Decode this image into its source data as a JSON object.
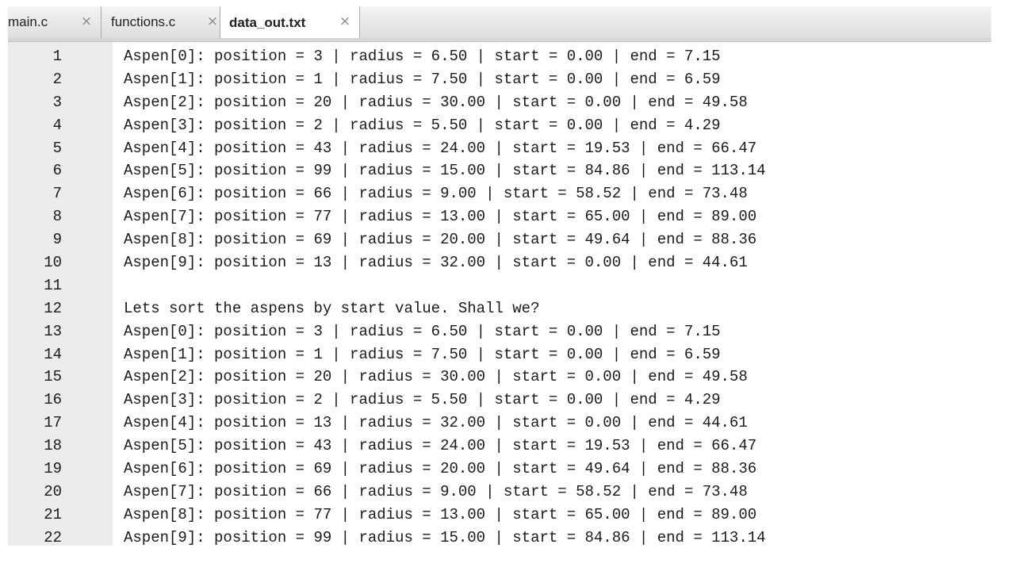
{
  "tabs": [
    {
      "label": "main.c",
      "active": false
    },
    {
      "label": "functions.c",
      "active": false
    },
    {
      "label": "data_out.txt",
      "active": true
    }
  ],
  "close_glyph": "×",
  "lines": [
    {
      "num": "1",
      "text": "Aspen[0]: position = 3 | radius = 6.50 | start = 0.00 | end = 7.15"
    },
    {
      "num": "2",
      "text": "Aspen[1]: position = 1 | radius = 7.50 | start = 0.00 | end = 6.59"
    },
    {
      "num": "3",
      "text": "Aspen[2]: position = 20 | radius = 30.00 | start = 0.00 | end = 49.58"
    },
    {
      "num": "4",
      "text": "Aspen[3]: position = 2 | radius = 5.50 | start = 0.00 | end = 4.29"
    },
    {
      "num": "5",
      "text": "Aspen[4]: position = 43 | radius = 24.00 | start = 19.53 | end = 66.47"
    },
    {
      "num": "6",
      "text": "Aspen[5]: position = 99 | radius = 15.00 | start = 84.86 | end = 113.14"
    },
    {
      "num": "7",
      "text": "Aspen[6]: position = 66 | radius = 9.00 | start = 58.52 | end = 73.48"
    },
    {
      "num": "8",
      "text": "Aspen[7]: position = 77 | radius = 13.00 | start = 65.00 | end = 89.00"
    },
    {
      "num": "9",
      "text": "Aspen[8]: position = 69 | radius = 20.00 | start = 49.64 | end = 88.36"
    },
    {
      "num": "10",
      "text": "Aspen[9]: position = 13 | radius = 32.00 | start = 0.00 | end = 44.61"
    },
    {
      "num": "11",
      "text": ""
    },
    {
      "num": "12",
      "text": "Lets sort the aspens by start value. Shall we?"
    },
    {
      "num": "13",
      "text": "Aspen[0]: position = 3 | radius = 6.50 | start = 0.00 | end = 7.15"
    },
    {
      "num": "14",
      "text": "Aspen[1]: position = 1 | radius = 7.50 | start = 0.00 | end = 6.59"
    },
    {
      "num": "15",
      "text": "Aspen[2]: position = 20 | radius = 30.00 | start = 0.00 | end = 49.58"
    },
    {
      "num": "16",
      "text": "Aspen[3]: position = 2 | radius = 5.50 | start = 0.00 | end = 4.29"
    },
    {
      "num": "17",
      "text": "Aspen[4]: position = 13 | radius = 32.00 | start = 0.00 | end = 44.61"
    },
    {
      "num": "18",
      "text": "Aspen[5]: position = 43 | radius = 24.00 | start = 19.53 | end = 66.47"
    },
    {
      "num": "19",
      "text": "Aspen[6]: position = 69 | radius = 20.00 | start = 49.64 | end = 88.36"
    },
    {
      "num": "20",
      "text": "Aspen[7]: position = 66 | radius = 9.00 | start = 58.52 | end = 73.48"
    },
    {
      "num": "21",
      "text": "Aspen[8]: position = 77 | radius = 13.00 | start = 65.00 | end = 89.00"
    },
    {
      "num": "22",
      "text": "Aspen[9]: position = 99 | radius = 15.00 | start = 84.86 | end = 113.14"
    }
  ]
}
